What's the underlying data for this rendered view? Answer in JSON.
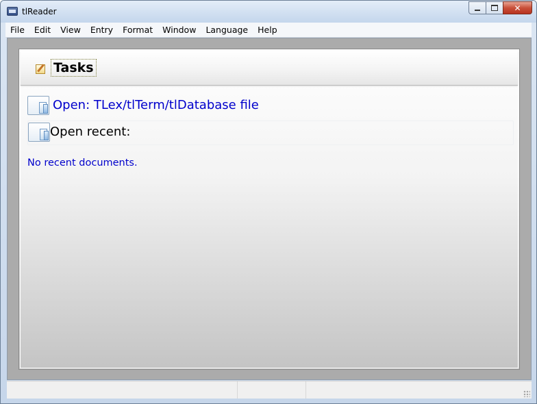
{
  "window": {
    "title": "tlReader",
    "icon": "app-window-icon",
    "caption_buttons": {
      "minimize": "minimize-icon",
      "maximize": "maximize-icon",
      "close": "✕"
    }
  },
  "menubar": {
    "items": [
      "File",
      "Edit",
      "View",
      "Entry",
      "Format",
      "Window",
      "Language",
      "Help"
    ]
  },
  "tasks": {
    "title": "Tasks",
    "icon": "edit-note-icon",
    "open": {
      "label": "Open: TLex/tlTerm/tlDatabase file",
      "icon": "open-document-icon"
    },
    "recent": {
      "label": "Open recent:",
      "icon": "recent-document-icon",
      "empty_text": "No recent documents."
    }
  },
  "statusbar": {
    "panels": [
      "",
      "",
      ""
    ]
  },
  "colors": {
    "link": "#0000cc",
    "mdi_background": "#ababab",
    "close_button": "#c9503a"
  }
}
